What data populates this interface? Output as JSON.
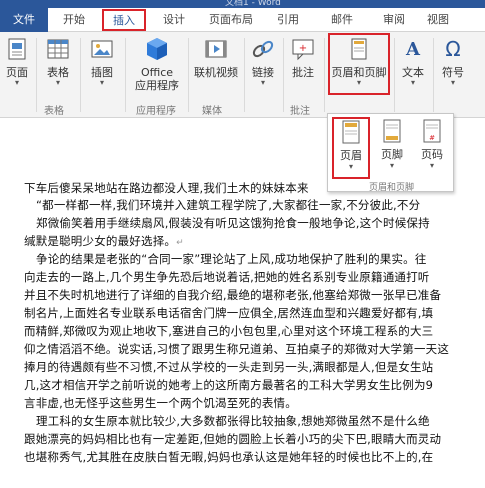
{
  "window": {
    "title": "文档1 - Word"
  },
  "tabs": {
    "file": "文件",
    "home": "开始",
    "insert": "插入",
    "design": "设计",
    "layout": "页面布局",
    "references": "引用",
    "mailings": "邮件",
    "review": "审阅",
    "view": "视图"
  },
  "ribbon": {
    "page": "页面",
    "table": "表格",
    "picture": "插图",
    "office_line1": "Office",
    "office_line2": "应用程序",
    "video": "联机视频",
    "link": "链接",
    "comment": "批注",
    "header_footer": "页眉和页脚",
    "text": "文本",
    "symbol": "符号",
    "group_table": "表格",
    "group_apps": "应用程序",
    "group_media": "媒体",
    "group_comment": "批注"
  },
  "dropdown": {
    "header": "页眉",
    "footer": "页脚",
    "page_number": "页码",
    "group_label": "页眉和页脚"
  },
  "document": {
    "lines": [
      "下车后傻呆呆地站在路边都没人理,我们土木的妹妹本来",
      "“都一样都一样,我们环境并入建筑工程学院了,大家都往一家,不分彼此,不分",
      "郑微偷笑着用手继续扇风,假装没有听见这饿狗抢食一般地争论,这个时候保持",
      "缄默是聪明少女的最好选择。",
      "争论的结果是老张的“合同一家”理论站了上风,成功地保护了胜利的果实。往",
      "向走去的一路上,几个男生争先恐后地说着话,把她的姓名系别专业原籍通通打听",
      "并且不失时机地进行了详细的自我介绍,最绝的堪称老张,他塞给郑微一张早已准备",
      "制名片,上面姓名专业联系电话宿舍门牌一应俱全,居然连血型和兴趣爱好都有,填",
      "而精鲜,郑微叹为观止地收下,塞进自己的小包包里,心里对这个环境工程系的大三",
      "仰之情滔滔不绝。说实话,习惯了跟男生称兄道弟、互拍桌子的郑微对大学第一天这",
      "捧月的待遇颇有些不习惯,不过从学校的一头走到另一头,满眼都是人,但是女生站",
      "几,这才相信开学之前听说的她考上的这所南方最著名的工科大学男女生比例为9",
      "言非虚,也无怪乎这些男生一个两个饥渴至死的表情。",
      "理工科的女生原本就比较少,大多数都张得比较抽象,想她郑微虽然不是什么绝",
      "跟她漂亮的妈妈相比也有一定差距,但她的圆脸上长着小巧的尖下巴,眼睛大而灵动",
      "也堪称秀气,尤其胜在皮肤白皙无暇,妈妈也承认这是她年轻的时候也比不上的,在"
    ],
    "paragraph_mark": "↵"
  }
}
